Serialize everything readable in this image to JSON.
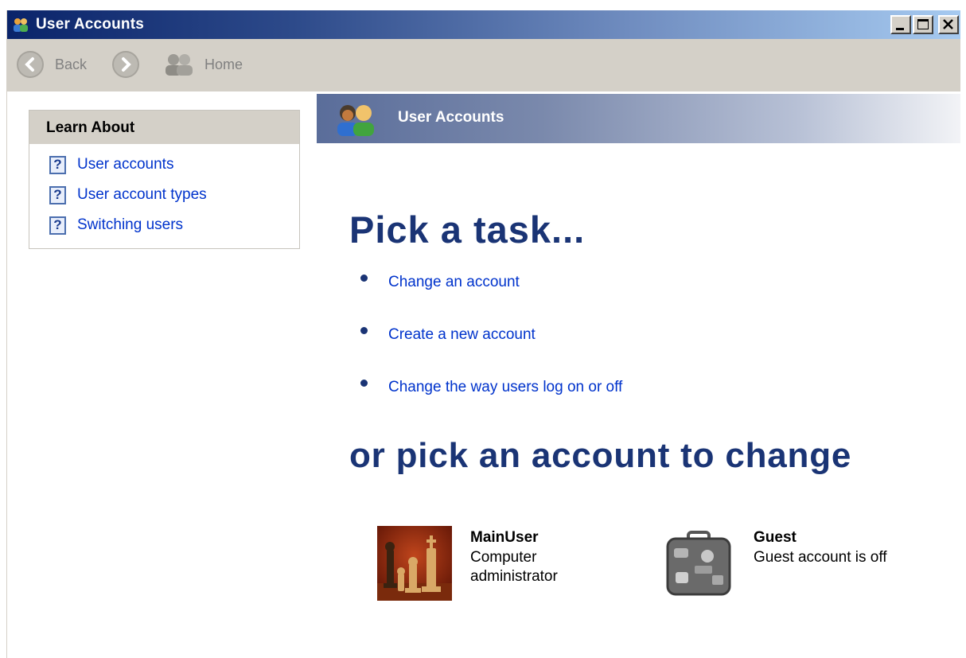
{
  "window": {
    "title": "User Accounts",
    "controls": {
      "minimize": "_",
      "maximize": "□",
      "close": "×"
    }
  },
  "toolbar": {
    "back_label": "Back",
    "home_label": "Home"
  },
  "learn_about": {
    "heading": "Learn About",
    "items": [
      {
        "label": "User accounts",
        "icon": "help-icon"
      },
      {
        "label": "User account types",
        "icon": "help-icon"
      },
      {
        "label": "Switching users",
        "icon": "help-icon"
      }
    ]
  },
  "header_bar": {
    "title": "User Accounts",
    "icon": "user-accounts-icon"
  },
  "main": {
    "pick_task_heading": "Pick a task...",
    "tasks": [
      {
        "label": "Change an account"
      },
      {
        "label": "Create a new account"
      },
      {
        "label": "Change the way users log on or off"
      }
    ],
    "pick_account_heading": "or pick an account to change",
    "accounts": [
      {
        "name": "MainUser",
        "desc_line1": "Computer",
        "desc_line2": "administrator",
        "picture": "chess-picture"
      },
      {
        "name": "Guest",
        "desc_line1": "Guest account is off",
        "desc_line2": "",
        "picture": "suitcase-picture"
      }
    ]
  },
  "colors": {
    "title_bar_start": "#0a246a",
    "title_bar_end": "#a6caf0",
    "heading": "#1a3475",
    "link": "#0033cc",
    "toolbar_bg": "#d4d0c8"
  }
}
